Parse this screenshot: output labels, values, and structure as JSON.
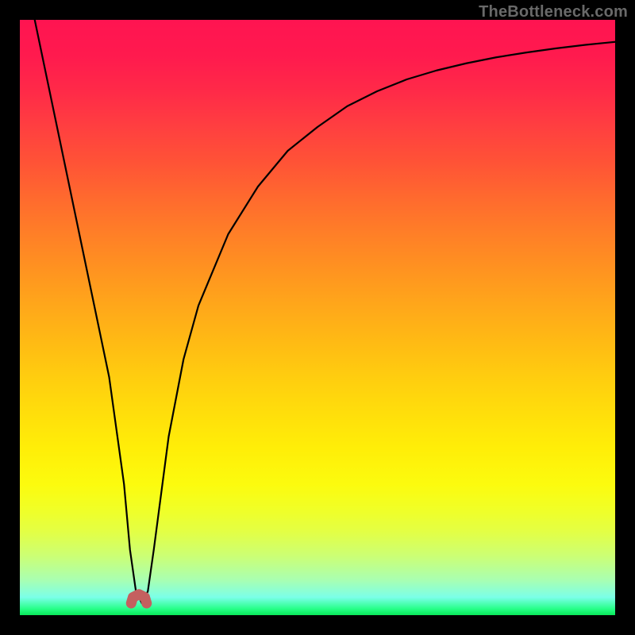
{
  "watermark": "TheBottleneck.com",
  "chart_data": {
    "type": "line",
    "title": "",
    "xlabel": "",
    "ylabel": "",
    "xlim": [
      0,
      100
    ],
    "ylim": [
      0,
      100
    ],
    "grid": false,
    "series": [
      {
        "name": "bottleneck-curve",
        "x": [
          2.5,
          5.0,
          7.5,
          10.0,
          12.5,
          15.0,
          17.5,
          18.5,
          19.5,
          20.5,
          21.5,
          22.5,
          25.0,
          27.5,
          30.0,
          35.0,
          40.0,
          45.0,
          50.0,
          55.0,
          60.0,
          65.0,
          70.0,
          75.0,
          80.0,
          85.0,
          90.0,
          95.0,
          100.0
        ],
        "values": [
          100,
          88,
          76,
          64,
          52,
          40,
          22,
          11,
          4,
          2,
          4,
          11,
          30,
          43,
          52,
          64,
          72,
          78,
          82,
          85.5,
          88,
          90,
          91.5,
          92.7,
          93.7,
          94.5,
          95.2,
          95.8,
          96.3
        ]
      }
    ],
    "annotations": [
      {
        "name": "zero-bottleneck-marker",
        "x": 20,
        "y_values": [
          2,
          3,
          3.5,
          3,
          2
        ],
        "x_offsets": [
          -1.3,
          -1.0,
          0,
          1.0,
          1.3
        ],
        "color": "#c4605f"
      }
    ]
  }
}
